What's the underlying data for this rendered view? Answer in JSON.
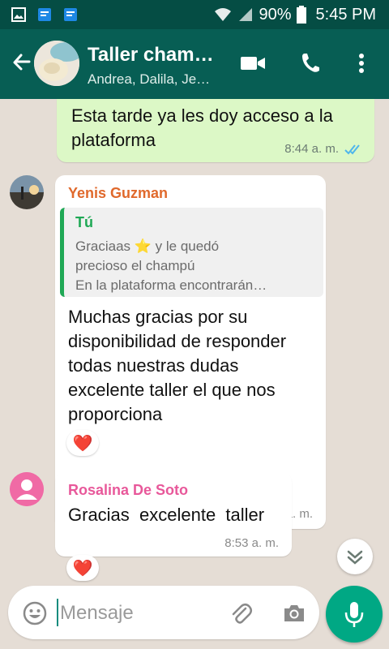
{
  "status_bar": {
    "battery": "90%",
    "time": "5:45 PM"
  },
  "header": {
    "title": "Taller cham…",
    "subtitle": "Andrea, Dalila, Je…"
  },
  "messages": {
    "outgoing": {
      "text": "Esta tarde ya les doy acceso a la plataforma",
      "time": "8:44 a. m."
    },
    "yenis": {
      "sender": "Yenis Guzman",
      "sender_color": "#e0692c",
      "quote_author": "Tú",
      "quote_line1": "Graciaas ⭐ y le quedó",
      "quote_line2": "precioso el champú",
      "quote_line3": "En la plataforma encontrarán…",
      "text": "Muchas gracias por su disponibilidad de responder todas nuestras dudas excelente taller el que nos proporciona",
      "time": "8:46 a. m.",
      "reaction": "❤️"
    },
    "rosalina": {
      "sender": "Rosalina De Soto",
      "sender_color": "#e8589a",
      "text": "Gracias  excelente  taller",
      "time": "8:53 a. m.",
      "reaction": "❤️"
    }
  },
  "composer": {
    "placeholder": "Mensaje"
  },
  "colors": {
    "header": "#075e54",
    "status_bar": "#054d44",
    "outgoing_bubble": "#dcf8c6",
    "accent": "#00a884"
  }
}
